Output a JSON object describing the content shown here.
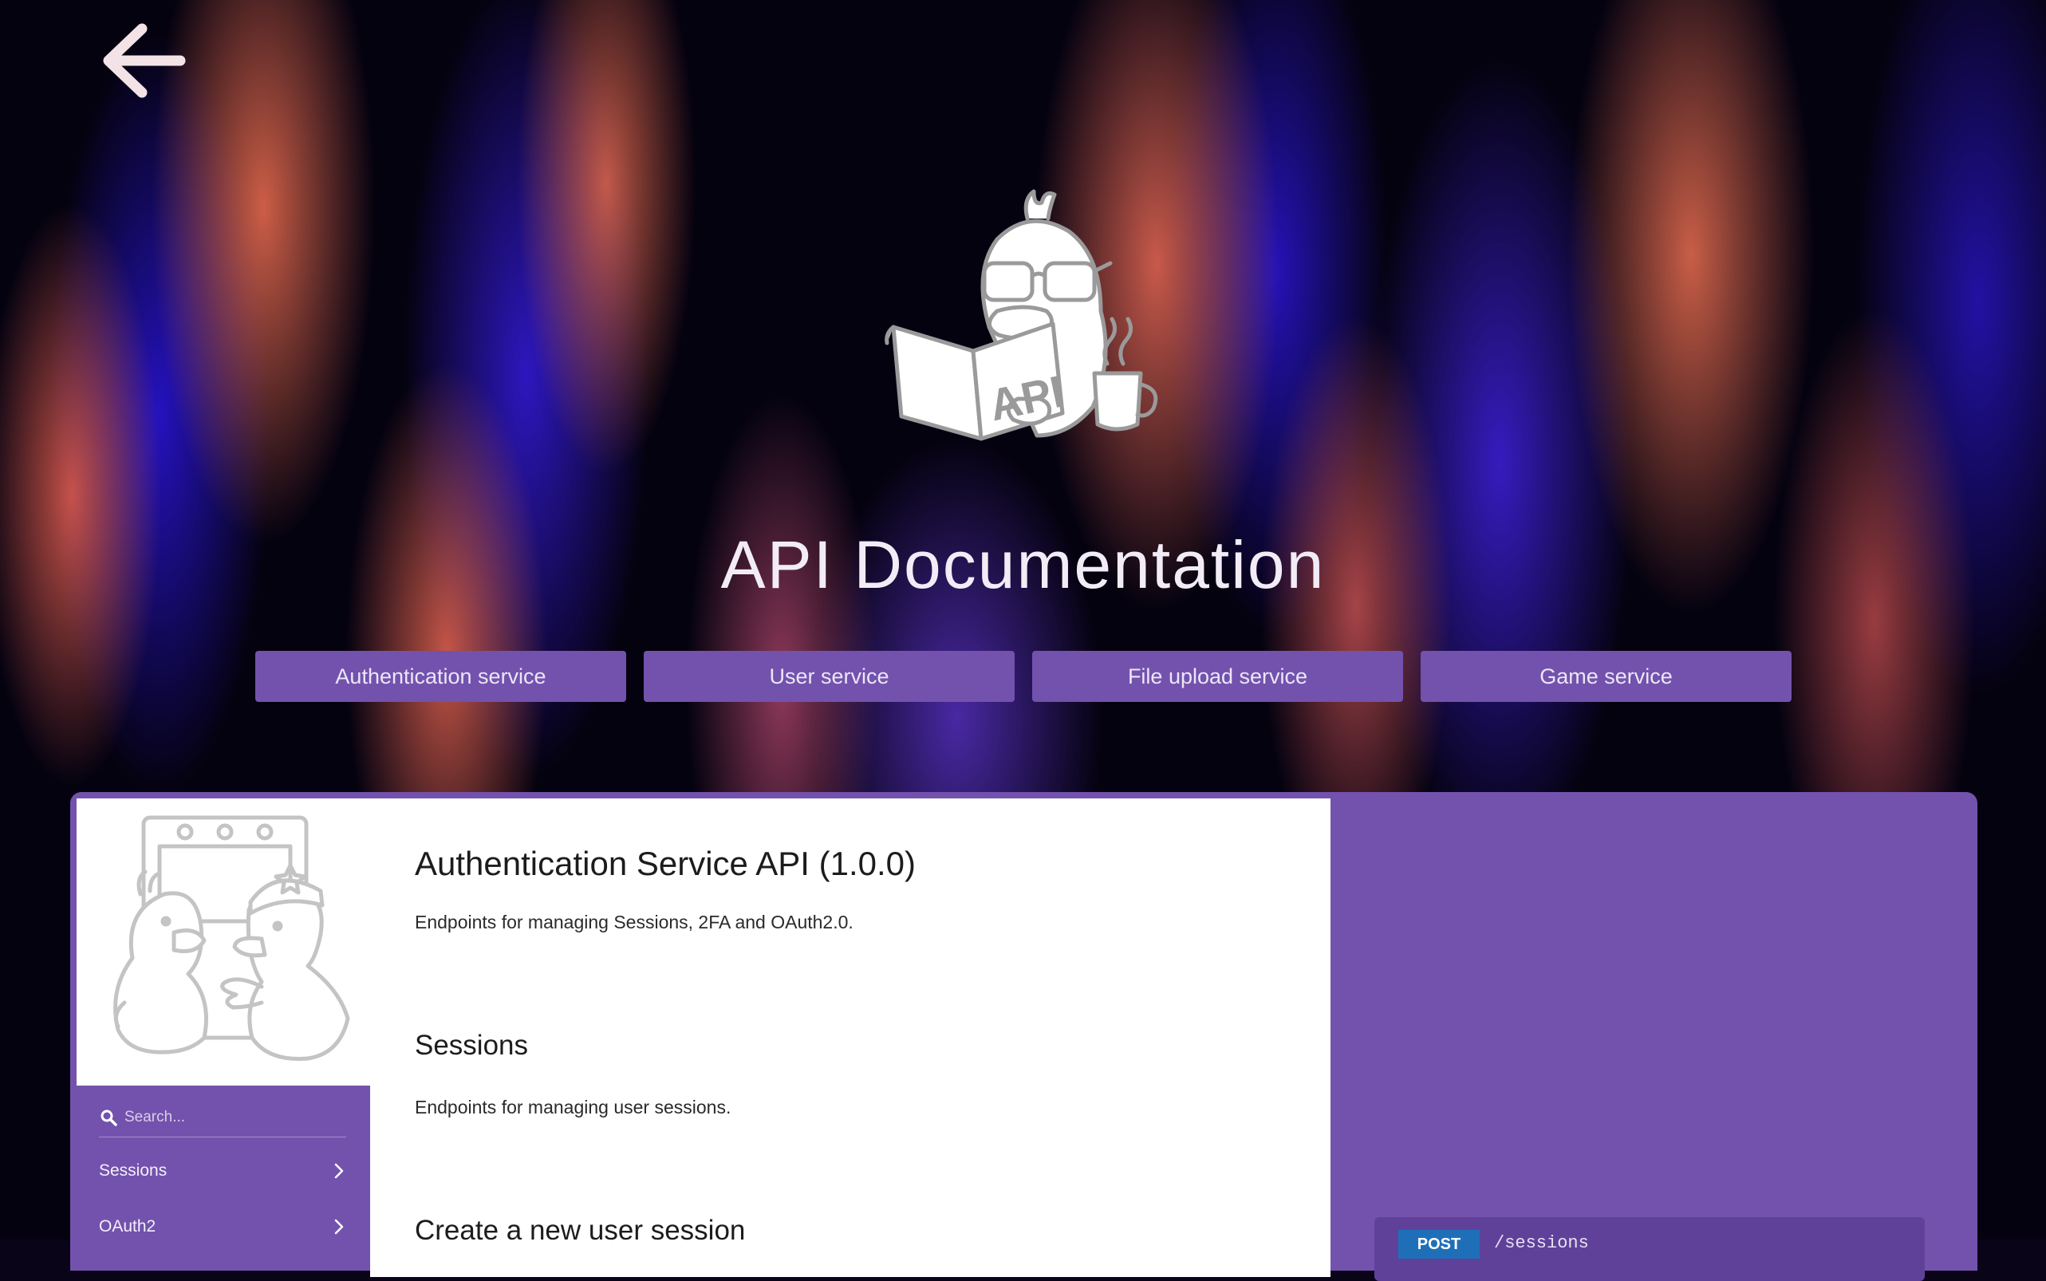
{
  "page": {
    "title": "API Documentation"
  },
  "tabs": [
    {
      "label": "Authentication service"
    },
    {
      "label": "User service"
    },
    {
      "label": "File upload service"
    },
    {
      "label": "Game service"
    }
  ],
  "search": {
    "placeholder": "Search..."
  },
  "sidebar": {
    "items": [
      {
        "label": "Sessions"
      },
      {
        "label": "OAuth2"
      }
    ]
  },
  "content": {
    "api_title": "Authentication Service API (1.0.0)",
    "api_description": "Endpoints for managing Sessions, 2FA and OAuth2.0.",
    "section_title": "Sessions",
    "section_description": "Endpoints for managing user sessions.",
    "endpoint_title": "Create a new user session"
  },
  "endpoint": {
    "method": "POST",
    "path": "/sessions"
  },
  "mascot": {
    "book_text": "API"
  },
  "colors": {
    "accent": "#7352ae",
    "panel": "#7352ae",
    "method_post": "#1f6fb8"
  }
}
